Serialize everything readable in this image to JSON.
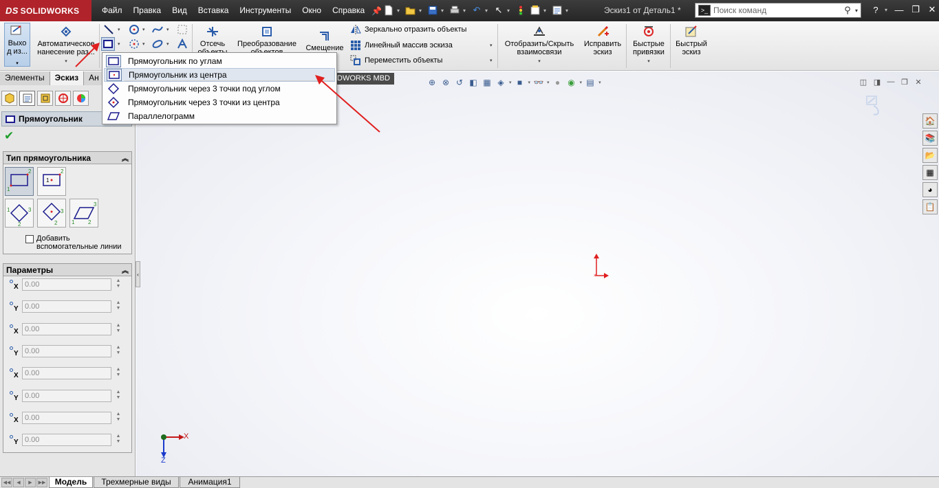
{
  "app": {
    "logo_prefix": "DS",
    "logo_name": "SOLIDWORKS",
    "doc_title": "Эскиз1 от Деталь1 *"
  },
  "menu": [
    "Файл",
    "Правка",
    "Вид",
    "Вставка",
    "Инструменты",
    "Окно",
    "Справка"
  ],
  "search": {
    "placeholder": "Поиск команд"
  },
  "ribbon": {
    "exit_sketch": "Выхо д из...",
    "smart_dim": "Автоматическое нанесение раз...",
    "trim": "Отсечь объекты",
    "convert": "Преобразование объектов",
    "offset": "Смещение",
    "mirror": "Зеркально отразить объекты",
    "linear_pattern": "Линейный массив эскиза",
    "move": "Переместить объекты",
    "display_relations": "Отобразить/Скрыть взаимосвязи",
    "repair": "Исправить эскиз",
    "quick_snaps": "Быстрые привязки",
    "rapid_sketch": "Быстрый эскиз"
  },
  "cm_tabs": [
    "Элементы",
    "Эскиз",
    "Ан"
  ],
  "mbd_tab": "DWORKS MBD",
  "dropdown": {
    "items": [
      "Прямоугольник по углам",
      "Прямоугольник из центра",
      "Прямоугольник через 3 точки под углом",
      "Прямоугольник через 3 точки из центра",
      "Параллелограмм"
    ],
    "hover_index": 1
  },
  "property_manager": {
    "title": "Прямоугольник",
    "type_group": "Тип прямоугольника",
    "add_construction_1": "Добавить",
    "add_construction_2": "вспомогательные линии",
    "params_group": "Параметры",
    "params": [
      {
        "axis": "X",
        "value": "0.00"
      },
      {
        "axis": "Y",
        "value": "0.00"
      },
      {
        "axis": "X",
        "value": "0.00"
      },
      {
        "axis": "Y",
        "value": "0.00"
      },
      {
        "axis": "X",
        "value": "0.00"
      },
      {
        "axis": "Y",
        "value": "0.00"
      },
      {
        "axis": "X",
        "value": "0.00"
      },
      {
        "axis": "Y",
        "value": "0.00"
      }
    ]
  },
  "triad": {
    "x": "X",
    "z": "Z"
  },
  "bottom_tabs": [
    "Модель",
    "Трехмерные виды",
    "Анимация1"
  ],
  "colors": {
    "brand_red": "#b0232a",
    "annotation_arrow": "#e02020",
    "origin_red": "#e02020"
  }
}
